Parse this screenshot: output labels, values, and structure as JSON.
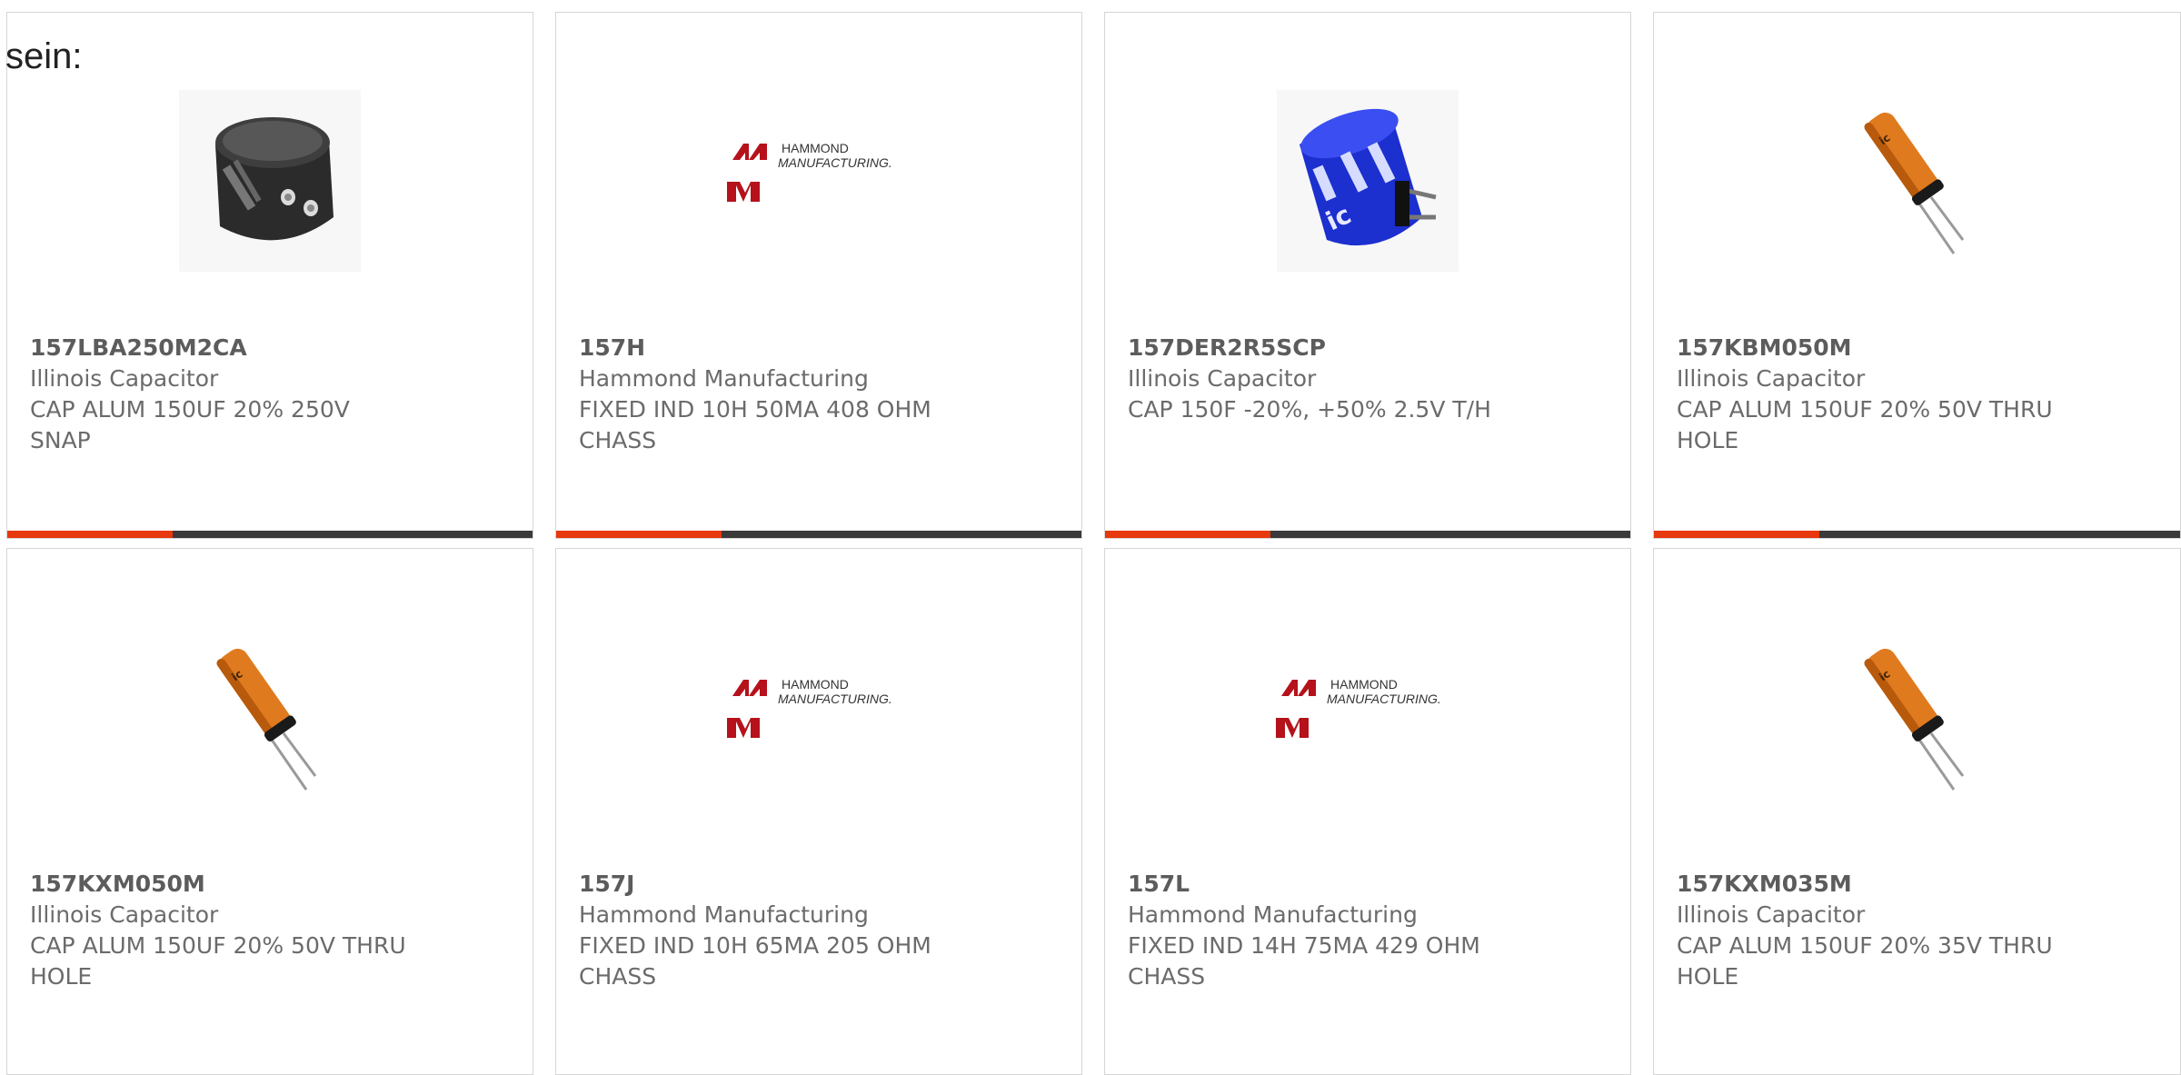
{
  "lead_text": "sein:",
  "colors": {
    "accent": "#e8380d",
    "bar": "#3a3a3a",
    "hammond_red": "#b5121b"
  },
  "products": [
    {
      "part": "157LBA250M2CA",
      "maker": "Illinois Capacitor",
      "desc1": "CAP ALUM 150UF 20% 250V",
      "desc2": "SNAP",
      "image": "black-snap-capacitor"
    },
    {
      "part": "157H",
      "maker": "Hammond Manufacturing",
      "desc1": "FIXED IND 10H 50MA 408 OHM",
      "desc2": "CHASS",
      "image": "hammond-logo"
    },
    {
      "part": "157DER2R5SCP",
      "maker": "Illinois Capacitor",
      "desc1": "CAP 150F -20%, +50% 2.5V T/H",
      "desc2": "",
      "image": "blue-supercapacitor"
    },
    {
      "part": "157KBM050M",
      "maker": "Illinois Capacitor",
      "desc1": "CAP ALUM 150UF 20% 50V THRU",
      "desc2": "HOLE",
      "image": "orange-radial-capacitor"
    },
    {
      "part": "157KXM050M",
      "maker": "Illinois Capacitor",
      "desc1": "CAP ALUM 150UF 20% 50V THRU",
      "desc2": "HOLE",
      "image": "orange-radial-capacitor"
    },
    {
      "part": "157J",
      "maker": "Hammond Manufacturing",
      "desc1": "FIXED IND 10H 65MA 205 OHM",
      "desc2": "CHASS",
      "image": "hammond-logo"
    },
    {
      "part": "157L",
      "maker": "Hammond Manufacturing",
      "desc1": "FIXED IND 14H 75MA 429 OHM",
      "desc2": "CHASS",
      "image": "hammond-logo"
    },
    {
      "part": "157KXM035M",
      "maker": "Illinois Capacitor",
      "desc1": "CAP ALUM 150UF 20% 35V THRU",
      "desc2": "HOLE",
      "image": "orange-radial-capacitor"
    }
  ],
  "logo": {
    "line1": "HAMMOND",
    "line2": "MANUFACTURING."
  }
}
